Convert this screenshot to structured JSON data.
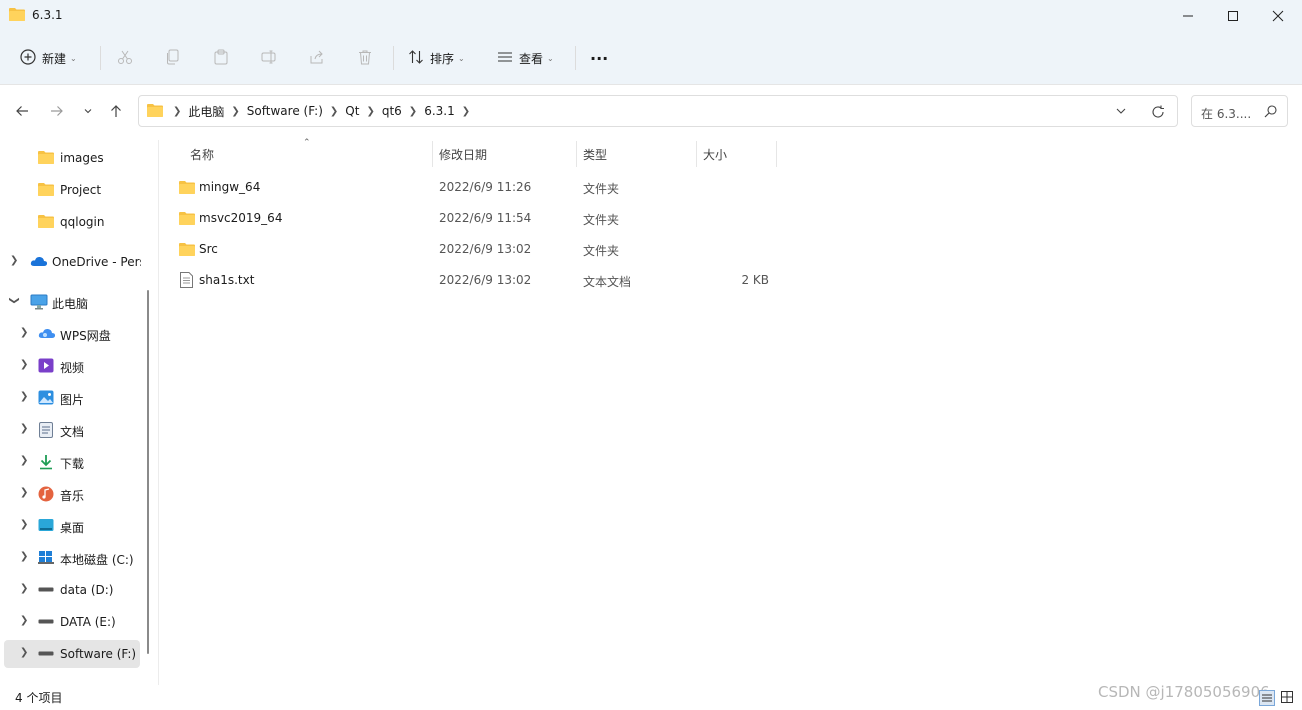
{
  "window": {
    "title": "6.3.1"
  },
  "toolbar": {
    "new_label": "新建",
    "sort_label": "排序",
    "view_label": "查看",
    "more_label": "···"
  },
  "address": {
    "crumbs": [
      "此电脑",
      "Software (F:)",
      "Qt",
      "qt6",
      "6.3.1"
    ],
    "search_placeholder": "在 6.3...."
  },
  "sidebar": {
    "items": [
      {
        "label": "images",
        "icon": "folder-icon"
      },
      {
        "label": "Project",
        "icon": "folder-icon"
      },
      {
        "label": "qqlogin",
        "icon": "folder-icon"
      },
      {
        "label": "OneDrive - Pers",
        "icon": "onedrive-icon"
      },
      {
        "label": "此电脑",
        "icon": "pc-icon"
      },
      {
        "label": "WPS网盘",
        "icon": "wps-cloud-icon"
      },
      {
        "label": "视频",
        "icon": "video-icon"
      },
      {
        "label": "图片",
        "icon": "pictures-icon"
      },
      {
        "label": "文档",
        "icon": "documents-icon"
      },
      {
        "label": "下载",
        "icon": "download-icon"
      },
      {
        "label": "音乐",
        "icon": "music-icon"
      },
      {
        "label": "桌面",
        "icon": "desktop-icon"
      },
      {
        "label": "本地磁盘 (C:)",
        "icon": "windows-drive-icon"
      },
      {
        "label": "data (D:)",
        "icon": "drive-icon"
      },
      {
        "label": "DATA (E:)",
        "icon": "drive-icon"
      },
      {
        "label": "Software (F:)",
        "icon": "drive-icon"
      }
    ]
  },
  "columns": {
    "name": "名称",
    "date": "修改日期",
    "type": "类型",
    "size": "大小"
  },
  "files": [
    {
      "name": "mingw_64",
      "date": "2022/6/9 11:26",
      "type": "文件夹",
      "size": "",
      "icon": "folder-icon"
    },
    {
      "name": "msvc2019_64",
      "date": "2022/6/9 11:54",
      "type": "文件夹",
      "size": "",
      "icon": "folder-icon"
    },
    {
      "name": "Src",
      "date": "2022/6/9 13:02",
      "type": "文件夹",
      "size": "",
      "icon": "folder-icon"
    },
    {
      "name": "sha1s.txt",
      "date": "2022/6/9 13:02",
      "type": "文本文档",
      "size": "2 KB",
      "icon": "text-file-icon"
    }
  ],
  "status": {
    "count": "4 个项目"
  },
  "watermark": "CSDN @j17805056906",
  "colors": {
    "chrome_bg": "#eef4f9",
    "folder": "#f7c244",
    "selected": "#e5e5e5"
  }
}
